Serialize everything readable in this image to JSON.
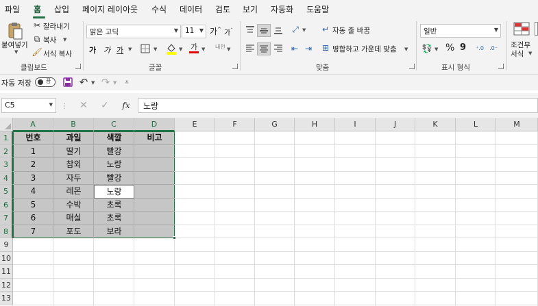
{
  "menu": [
    "파일",
    "홈",
    "삽입",
    "페이지 레이아웃",
    "수식",
    "데이터",
    "검토",
    "보기",
    "자동화",
    "도움말"
  ],
  "ribbon": {
    "clipboard": {
      "paste": "붙여넣기",
      "cut": "잘라내기",
      "copy": "복사",
      "format_painter": "서식 복사",
      "group": "클립보드"
    },
    "font": {
      "name": "맑은 고딕",
      "size": "11",
      "grow": "가",
      "shrink": "가",
      "bold": "가",
      "italic": "가",
      "underline": "가",
      "font_color_glyph": "가",
      "phonetic": "내천",
      "group": "글꼴"
    },
    "alignment": {
      "wrap": "자동 줄 바꿈",
      "merge": "병합하고 가운데 맞춤",
      "group": "맞춤"
    },
    "number": {
      "format": "일반",
      "percent": "%",
      "comma": "9",
      "group": "표시 형식"
    },
    "styles": {
      "conditional_line1": "조건부",
      "conditional_line2": "서식"
    }
  },
  "qat": {
    "autosave": "자동 저장",
    "toggle": "끔"
  },
  "formula": {
    "name_box": "C5",
    "value": "노랑",
    "fx": "fx"
  },
  "columns": [
    "A",
    "B",
    "C",
    "D",
    "E",
    "F",
    "G",
    "H",
    "I",
    "J",
    "K",
    "L",
    "M"
  ],
  "rows": [
    "1",
    "2",
    "3",
    "4",
    "5",
    "6",
    "7",
    "8",
    "9",
    "10",
    "11",
    "12",
    "13"
  ],
  "table": {
    "headers": [
      "번호",
      "과일",
      "색깔",
      "비고"
    ],
    "rows": [
      [
        "1",
        "딸기",
        "빨강",
        ""
      ],
      [
        "2",
        "참외",
        "노랑",
        ""
      ],
      [
        "3",
        "자두",
        "빨강",
        ""
      ],
      [
        "4",
        "레몬",
        "노랑",
        ""
      ],
      [
        "5",
        "수박",
        "초록",
        ""
      ],
      [
        "6",
        "매실",
        "초록",
        ""
      ],
      [
        "7",
        "포도",
        "보라",
        ""
      ]
    ]
  },
  "colors": {
    "accent": "#217346",
    "selection": "#c6c6c6",
    "font_color": "#e00000",
    "highlight": "#ffff00"
  }
}
